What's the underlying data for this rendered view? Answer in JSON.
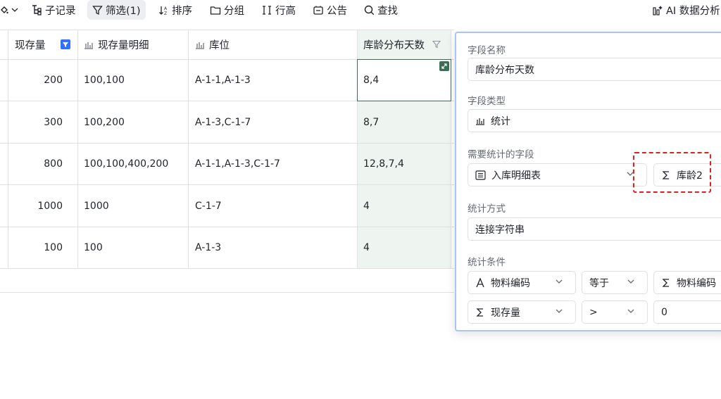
{
  "toolbar": {
    "subrecord": "子记录",
    "filter": "筛选(1)",
    "sort": "排序",
    "group": "分组",
    "rowheight": "行高",
    "notice": "公告",
    "search": "查找",
    "ai": "AI 数据分析"
  },
  "table": {
    "headers": {
      "stock": "现存量",
      "detail": "现存量明细",
      "location": "库位",
      "age": "库龄分布天数"
    },
    "rows": [
      {
        "stock": "200",
        "detail": "100,100",
        "location": "A-1-1,A-1-3",
        "age": "8,4"
      },
      {
        "stock": "300",
        "detail": "100,200",
        "location": "A-1-3,C-1-7",
        "age": "8,7"
      },
      {
        "stock": "800",
        "detail": "100,100,400,200",
        "location": "A-1-1,A-1-3,C-1-7",
        "age": "12,8,7,4"
      },
      {
        "stock": "1000",
        "detail": "1000",
        "location": "C-1-7",
        "age": "4"
      },
      {
        "stock": "100",
        "detail": "100",
        "location": "A-1-3",
        "age": "4"
      }
    ]
  },
  "panel": {
    "field_name_label": "字段名称",
    "field_name_value": "库龄分布天数",
    "field_type_label": "字段类型",
    "field_type_value": "统计",
    "stat_field_label": "需要统计的字段",
    "stat_field_source": "入库明细表",
    "stat_field_target": "库龄2",
    "stat_method_label": "统计方式",
    "stat_method_value": "连接字符串",
    "stat_cond_label": "统计条件",
    "cond1": {
      "field": "物料编码",
      "op": "等于",
      "value": "物料编码"
    },
    "cond2": {
      "field": "现存量",
      "op": ">",
      "value": "0"
    }
  },
  "colors": {
    "accent": "#3b6e55",
    "highlight": "#eef5f1",
    "dashed": "#e02020",
    "panel_border": "#a9c4f5"
  }
}
